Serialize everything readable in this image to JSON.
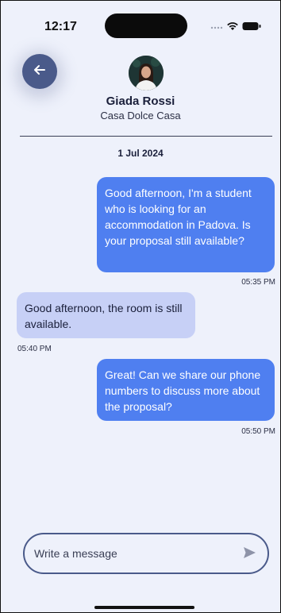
{
  "status_bar": {
    "time": "12:17",
    "icons": [
      "signal-icon",
      "wifi-icon",
      "battery-icon"
    ]
  },
  "header": {
    "back_icon": "arrow-left-icon",
    "contact_name": "Giada Rossi",
    "contact_subtitle": "Casa Dolce Casa"
  },
  "chat": {
    "date": "1 Jul 2024",
    "messages": [
      {
        "direction": "sent",
        "text": "Good afternoon, I'm a student who is looking for an accommodation in Padova. Is your proposal still available?",
        "time": "05:35 PM"
      },
      {
        "direction": "received",
        "text": "Good afternoon, the room is still available.",
        "time": "05:40 PM"
      },
      {
        "direction": "sent",
        "text": "Great! Can we share our phone numbers to discuss more about the proposal?",
        "time": "05:50 PM"
      }
    ]
  },
  "composer": {
    "placeholder": "Write a message",
    "value": "",
    "send_icon": "send-icon"
  },
  "colors": {
    "background": "#eef1fb",
    "sent_bubble": "#4f7ff0",
    "received_bubble": "#c7d0f6",
    "accent": "#4a5a8a"
  }
}
